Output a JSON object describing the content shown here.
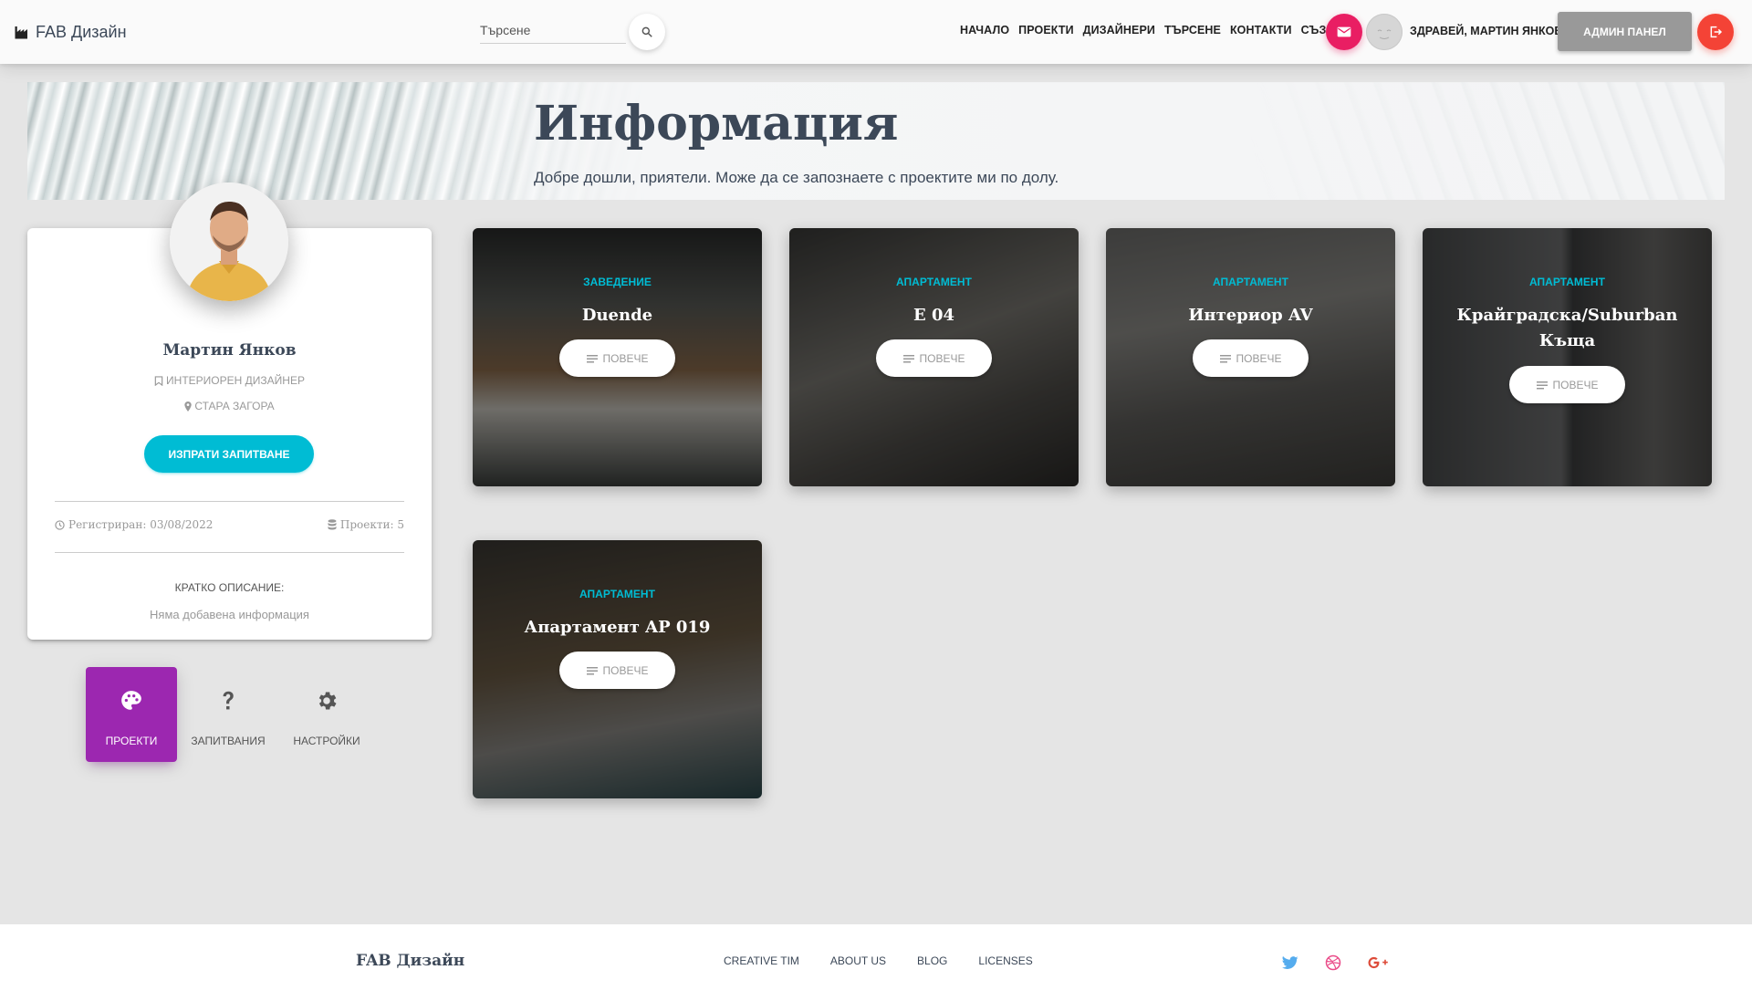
{
  "navbar": {
    "brand": "FAB Дизайн",
    "search_placeholder": "Търсене",
    "links": [
      "НАЧАЛО",
      "ПРОЕКТИ",
      "ДИЗАЙНЕРИ",
      "ТЪРСЕНЕ",
      "КОНТАКТИ",
      "СЪЗДАЙ"
    ],
    "greeting": "ЗДРАВЕЙ, МАРТИН ЯНКОВ!",
    "admin_label": "АДМИН ПАНЕЛ"
  },
  "hero": {
    "title": "Информация",
    "subtitle": "Добре дошли, приятели. Може да се запознаете с проектите ми по долу."
  },
  "profile": {
    "name": "Мартин Янков",
    "role": "ИНТЕРИОРЕН ДИЗАЙНЕР",
    "city": "СТАРА ЗАГОРА",
    "inquiry_label": "ИЗПРАТИ ЗАПИТВАНЕ",
    "registered": "Регистриран: 03/08/2022",
    "projects_count": "Проекти: 5",
    "desc_label": "КРАТКО ОПИСАНИЕ:",
    "desc_text": "Няма добавена информация"
  },
  "tabs": [
    {
      "label": "ПРОЕКТИ",
      "active": true
    },
    {
      "label": "ЗАПИТВАНИЯ",
      "active": false
    },
    {
      "label": "НАСТРОЙКИ",
      "active": false
    }
  ],
  "projects": [
    {
      "category": "ЗАВЕДЕНИЕ",
      "title": "Duende",
      "more": "ПОВЕЧЕ"
    },
    {
      "category": "АПАРТАМЕНТ",
      "title": "E 04",
      "more": "ПОВЕЧЕ"
    },
    {
      "category": "АПАРТАМЕНТ",
      "title": "Интериор AV",
      "more": "ПОВЕЧЕ"
    },
    {
      "category": "АПАРТАМЕНТ",
      "title": "Крайградска/Suburban Къща",
      "more": "ПОВЕЧЕ"
    },
    {
      "category": "АПАРТАМЕНТ",
      "title": "Апартамент AP 019",
      "more": "ПОВЕЧЕ"
    }
  ],
  "footer": {
    "brand": "FAB Дизайн",
    "links": [
      "CREATIVE TIM",
      "ABOUT US",
      "BLOG",
      "LICENSES"
    ]
  },
  "colors": {
    "accent_cyan": "#00bcd4",
    "purple": "#9c27b0",
    "pink": "#e91e63",
    "red": "#f44336",
    "admin_gray": "#999999",
    "twitter": "#55acee",
    "dribbble": "#ea4c89",
    "google": "#dd4b39"
  },
  "icons": [
    "factory-icon",
    "search-icon",
    "mail-icon",
    "avatar-placeholder",
    "logout-icon",
    "bookmark-icon",
    "location-icon",
    "clock-icon",
    "database-icon",
    "palette-icon",
    "question-icon",
    "gear-icon",
    "list-icon",
    "twitter-icon",
    "dribbble-icon",
    "google-plus-icon"
  ]
}
